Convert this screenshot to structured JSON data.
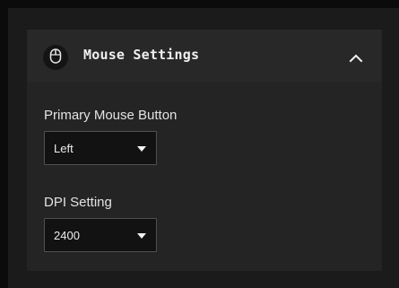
{
  "header": {
    "title": "Mouse Settings",
    "icon": "mouse-icon",
    "toggle_icon": "chevron-up-icon"
  },
  "fields": {
    "primary_button": {
      "label": "Primary Mouse Button",
      "value": "Left"
    },
    "dpi": {
      "label": "DPI Setting",
      "value": "2400"
    }
  },
  "colors": {
    "page_background": "#0b0b0b",
    "frame_background": "#1b1b1b",
    "panel_background": "#242424",
    "select_background": "#121212",
    "select_border": "#505050",
    "text": "#e6e6e6"
  }
}
